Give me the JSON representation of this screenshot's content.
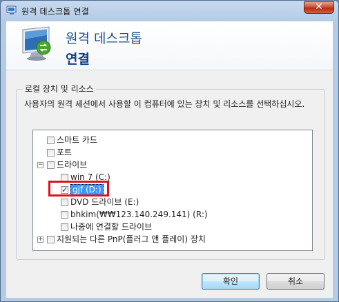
{
  "window": {
    "title": "원격 데스크톱 연결",
    "close_glyph": "✕"
  },
  "header": {
    "line1": "원격 데스크톱",
    "line2": "연결"
  },
  "group": {
    "title": "로컬 장치 및 리소스",
    "description": "사용자의 원격 세션에서 사용할 이 컴퓨터에 있는 장치 및 리소스를 선택하십시오."
  },
  "tree": {
    "items": [
      {
        "label": "스마트 카드",
        "checked": false
      },
      {
        "label": "포트",
        "checked": false
      },
      {
        "label": "드라이브",
        "checked": false,
        "expander": "−"
      },
      {
        "label": "win 7 (C:)",
        "checked": false
      },
      {
        "label": "gjf (D:)",
        "checked": true,
        "selected": true
      },
      {
        "label": "DVD 드라이브 (E:)",
        "checked": false
      },
      {
        "label": "bhkim(₩₩123.140.249.141) (R:)",
        "checked": false
      },
      {
        "label": "나중에 연결할 드라이브",
        "checked": false
      },
      {
        "label": "지원되는 다른 PnP(플러그 앤 플레이) 장치",
        "checked": false,
        "expander": "+"
      }
    ]
  },
  "buttons": {
    "ok": "확인",
    "cancel": "취소"
  },
  "colors": {
    "accent": "#3399ff",
    "highlight": "#e01020",
    "header_text": "#1c4f8c"
  }
}
